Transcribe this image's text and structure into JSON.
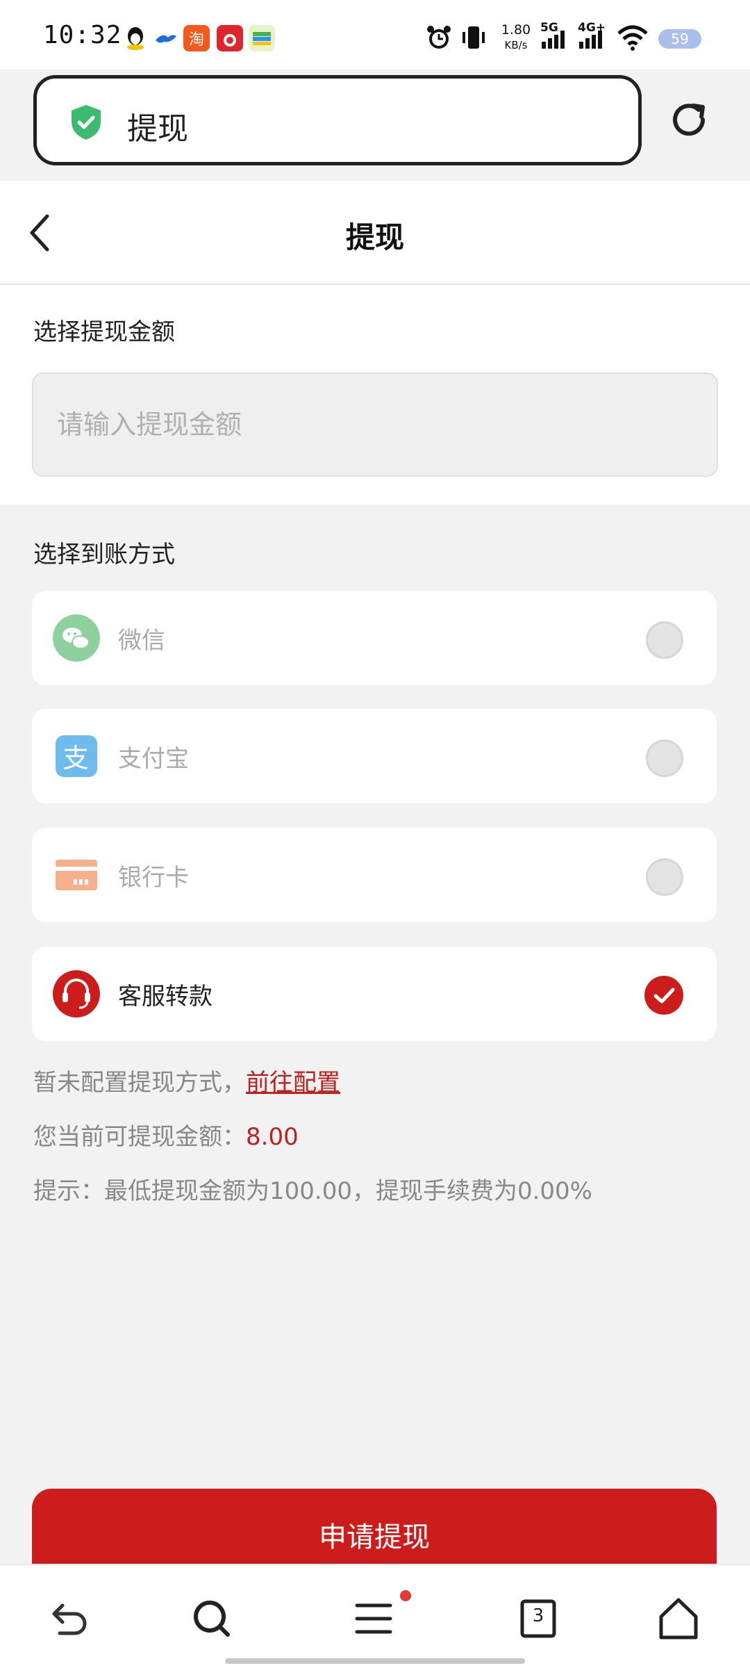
{
  "status_bar": {
    "time": "10:32",
    "network_speed": "1.80",
    "network_unit": "KB/s",
    "signal_1": "5G",
    "signal_2": "4G+",
    "battery": "59"
  },
  "url_bar": {
    "title": "提现"
  },
  "header": {
    "title": "提现"
  },
  "amount": {
    "label": "选择提现金额",
    "placeholder": "请输入提现金额"
  },
  "methods": {
    "label": "选择到账方式",
    "items": [
      {
        "label": "微信",
        "icon": "wechat-icon",
        "selected": false,
        "color": "#8fd19e"
      },
      {
        "label": "支付宝",
        "icon": "alipay-icon",
        "selected": false,
        "color": "#6ebbed"
      },
      {
        "label": "银行卡",
        "icon": "bank-card-icon",
        "selected": false,
        "color": "#f7b08a"
      },
      {
        "label": "客服转款",
        "icon": "customer-service-icon",
        "selected": true,
        "color": "#cc1c1c"
      }
    ]
  },
  "notice": {
    "not_configured": "暂未配置提现方式，",
    "config_link": "前往配置",
    "balance_label": "您当前可提现金额：",
    "balance_value": "8.00",
    "tip": "提示：最低提现金额为100.00，提现手续费为0.00%"
  },
  "apply_button": "申请提现",
  "bottom_nav": {
    "tabs_count": "3"
  },
  "colors": {
    "accent": "#cc1c1c",
    "background": "#f2f2f2"
  }
}
